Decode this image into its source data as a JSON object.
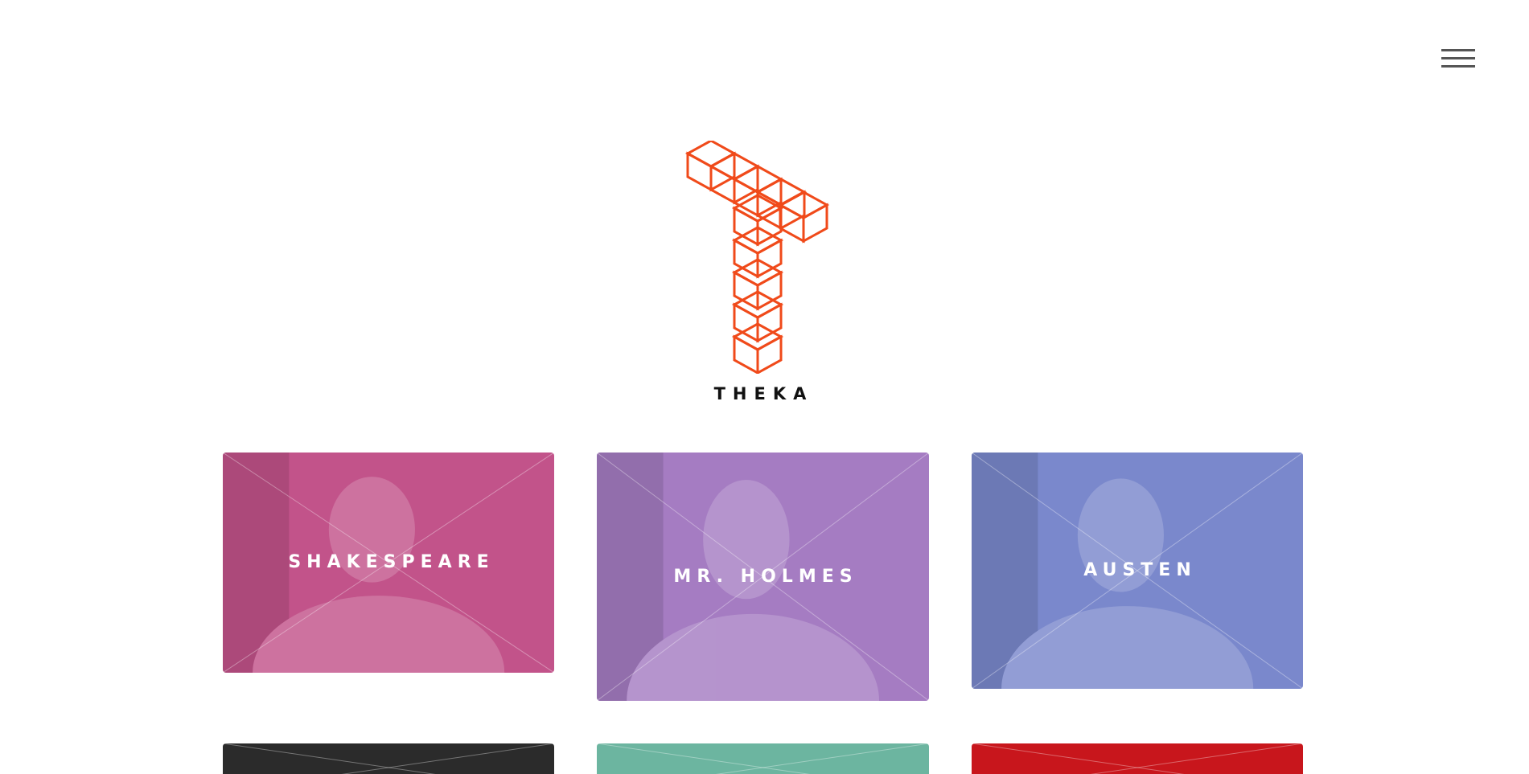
{
  "header": {
    "menu_icon": "hamburger-menu-icon"
  },
  "logo": {
    "icon": "isometric-cubes-logo-icon",
    "text": "THEKA",
    "color": "#f04a1a"
  },
  "cards": [
    {
      "label": "SHAKESPEARE",
      "tint": "#c2538a"
    },
    {
      "label": "MR. HOLMES",
      "tint": "#a57cc2"
    },
    {
      "label": "AUSTEN",
      "tint": "#7a88cc"
    },
    {
      "label": "",
      "tint": "#2b2b2b"
    },
    {
      "label": "",
      "tint": "#6cb5a0"
    },
    {
      "label": "",
      "tint": "#c8161c"
    }
  ]
}
